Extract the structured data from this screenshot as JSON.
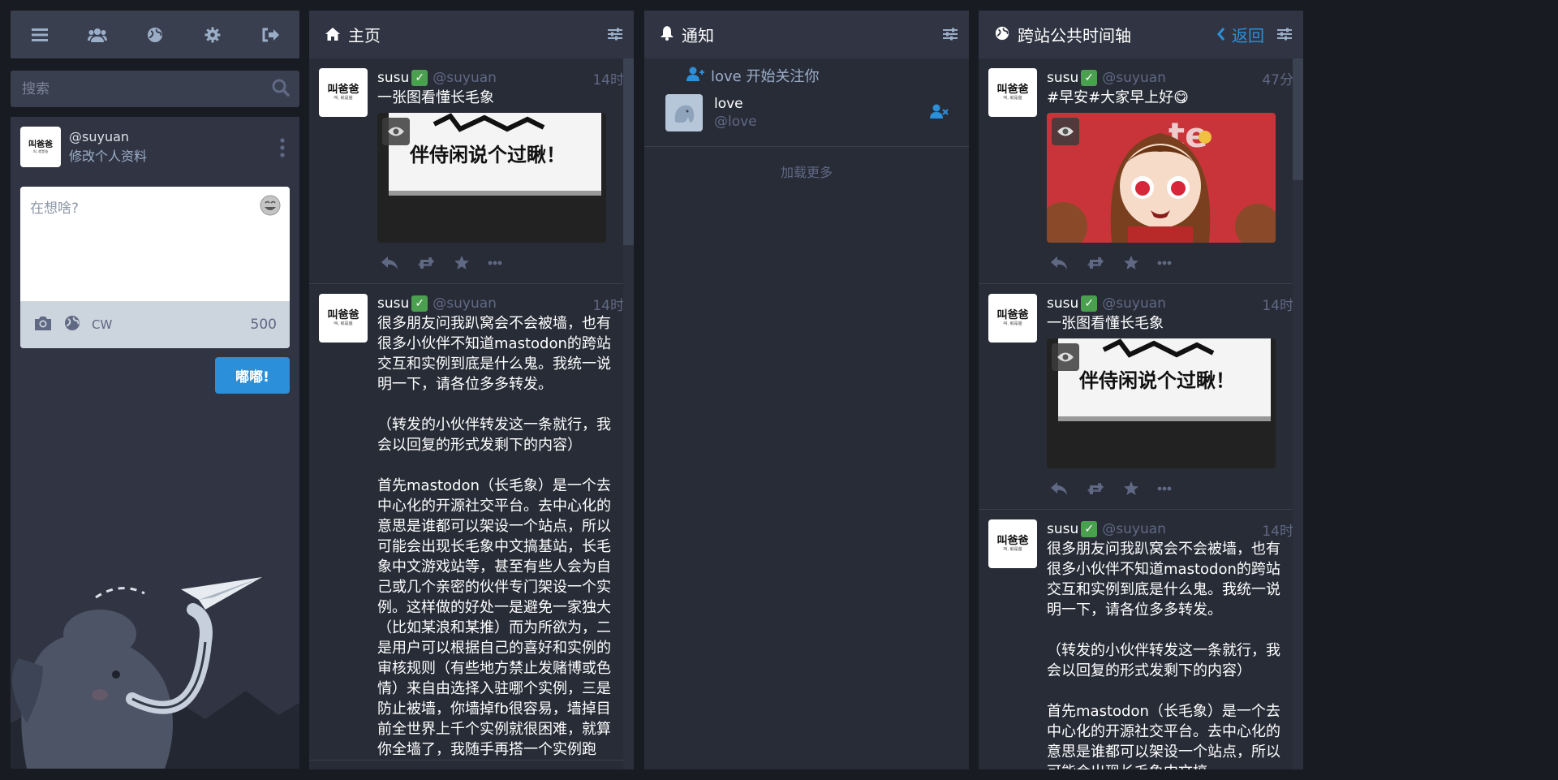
{
  "drawer": {
    "search_placeholder": "搜索",
    "profile": {
      "acct": "@suyuan",
      "edit_label": "修改个人资料",
      "avatar_text": "叫爸爸",
      "avatar_small": "叫, 就是爸"
    },
    "compose": {
      "placeholder": "在想啥?",
      "cw_label": "CW",
      "char_count": "500",
      "toot_label": "嘟嘟!"
    }
  },
  "columns": {
    "home": {
      "title": "主页",
      "statuses": [
        {
          "name": "susu",
          "handle": "@suyuan",
          "time": "14时",
          "text": "一张图看懂长毛象",
          "avatar_text": "叫爸爸",
          "avatar_small": "叫, 就是爸"
        },
        {
          "name": "susu",
          "handle": "@suyuan",
          "time": "14时",
          "text": "很多朋友问我趴窝会不会被墙，也有很多小伙伴不知道mastodon的跨站交互和实例到底是什么鬼。我统一说明一下，请各位多多转发。\n\n（转发的小伙伴转发这一条就行，我会以回复的形式发剩下的内容）\n\n首先mastodon（长毛象）是一个去中心化的开源社交平台。去中心化的意思是谁都可以架设一个站点，所以可能会出现长毛象中文搞基站，长毛象中文游戏站等，甚至有些人会为自己或几个亲密的伙伴专门架设一个实例。这样做的好处一是避免一家独大（比如某浪和某推）而为所欲为，二是用户可以根据自己的喜好和实例的审核规则（有些地方禁止发赌博或色情）来自由选择入驻哪个实例，三是防止被墙，你墙掉fb很容易，墙掉目前全世界上千个实例就很困难，就算你全墙了，我随手再搭一个实例跑",
          "avatar_text": "叫爸爸",
          "avatar_small": "叫, 就是爸"
        }
      ]
    },
    "notifications": {
      "title": "通知",
      "items": [
        {
          "text": "love 开始关注你",
          "display_name": "love",
          "acct": "@love"
        }
      ],
      "load_more": "加载更多"
    },
    "public": {
      "title": "跨站公共时间轴",
      "back_label": "返回",
      "statuses": [
        {
          "name": "susu",
          "handle": "@suyuan",
          "time": "47分",
          "text": "#早安#大家早上好😋",
          "avatar_text": "叫爸爸",
          "avatar_small": "叫, 就是爸"
        },
        {
          "name": "susu",
          "handle": "@suyuan",
          "time": "14时",
          "text": "一张图看懂长毛象",
          "avatar_text": "叫爸爸",
          "avatar_small": "叫, 就是爸"
        },
        {
          "name": "susu",
          "handle": "@suyuan",
          "time": "14时",
          "text": "很多朋友问我趴窝会不会被墙，也有很多小伙伴不知道mastodon的跨站交互和实例到底是什么鬼。我统一说明一下，请各位多多转发。\n\n（转发的小伙伴转发这一条就行，我会以回复的形式发剩下的内容）\n\n首先mastodon（长毛象）是一个去中心化的开源社交平台。去中心化的意思是谁都可以架设一个站点，所以可能会出现长毛象中文搞",
          "avatar_text": "叫爸爸",
          "avatar_small": "叫, 就是爸"
        }
      ]
    }
  },
  "media_caption": "伴侍闲说个过瞅！",
  "colors": {
    "accent": "#2b90d9",
    "background": "#191b22",
    "column": "#282c37",
    "header": "#313543",
    "verified": "#4ba04f"
  },
  "icons": [
    "menu-icon",
    "people-icon",
    "globe-icon",
    "gear-icon",
    "logout-icon",
    "search-icon",
    "home-icon",
    "bell-icon",
    "sliders-icon",
    "chevron-left-icon",
    "reply-icon",
    "boost-icon",
    "star-icon",
    "ellipsis-icon",
    "camera-icon",
    "eye-icon",
    "follow-icon",
    "unfollow-icon",
    "emoji-icon",
    "kebab-icon"
  ]
}
